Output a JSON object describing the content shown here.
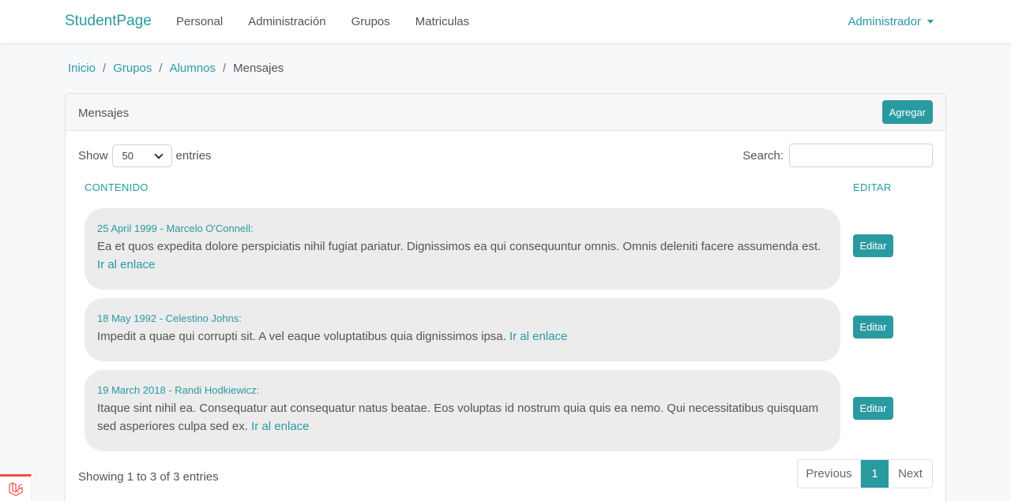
{
  "navbar": {
    "brand": "StudentPage",
    "links": [
      "Personal",
      "Administración",
      "Grupos",
      "Matriculas"
    ],
    "user": "Administrador"
  },
  "breadcrumb": {
    "items": [
      "Inicio",
      "Grupos",
      "Alumnos"
    ],
    "active": "Mensajes",
    "separator": "/"
  },
  "card": {
    "title": "Mensajes",
    "add_label": "Agregar"
  },
  "table": {
    "show_label": "Show",
    "entries_label": "entries",
    "page_size": "50",
    "search_label": "Search:",
    "search_value": "",
    "headers": {
      "content": "CONTENIDO",
      "edit": "EDITAR"
    },
    "rows": [
      {
        "meta": "25 April 1999 - Marcelo O'Connell:",
        "text": "Ea et quos expedita dolore perspiciatis nihil fugiat pariatur. Dignissimos ea qui consequuntur omnis. Omnis deleniti facere assumenda est.",
        "link": "Ir al enlace",
        "edit_label": "Editar"
      },
      {
        "meta": "18 May 1992 - Celestino Johns:",
        "text": "Impedit a quae qui corrupti sit. A vel eaque voluptatibus quia dignissimos ipsa.",
        "link": "Ir al enlace",
        "edit_label": "Editar"
      },
      {
        "meta": "19 March 2018 - Randi Hodkiewicz:",
        "text": "Itaque sint nihil ea. Consequatur aut consequatur natus beatae. Eos voluptas id nostrum quia quis ea nemo. Qui necessitatibus quisquam sed asperiores culpa sed ex.",
        "link": "Ir al enlace",
        "edit_label": "Editar"
      }
    ],
    "info": "Showing 1 to 3 of 3 entries"
  },
  "pagination": {
    "previous": "Previous",
    "current": "1",
    "next": "Next"
  },
  "colors": {
    "accent": "#2a9aa1",
    "message_bg": "#ececed",
    "laravel": "#ef4b47"
  }
}
